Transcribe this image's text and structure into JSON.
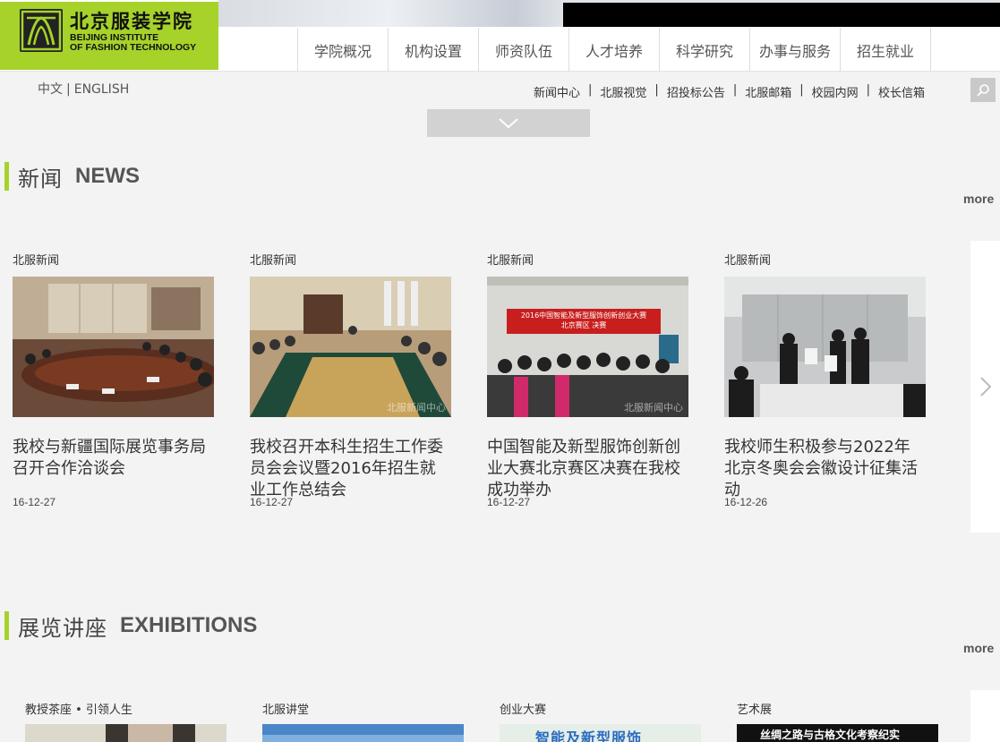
{
  "header": {
    "logo_cn": "北京服装学院",
    "logo_en_line1": "BEIJING INSTITUTE",
    "logo_en_line2": "OF FASHION TECHNOLOGY"
  },
  "nav": {
    "items": [
      {
        "label": "学院概况"
      },
      {
        "label": "机构设置"
      },
      {
        "label": "师资队伍"
      },
      {
        "label": "人才培养"
      },
      {
        "label": "科学研究"
      },
      {
        "label": "办事与服务"
      },
      {
        "label": "招生就业"
      }
    ]
  },
  "lang": {
    "cn": "中文",
    "sep": "|",
    "en": "ENGLISH"
  },
  "quicklinks": {
    "sep": "|",
    "items": [
      {
        "label": "新闻中心"
      },
      {
        "label": "北服视觉"
      },
      {
        "label": "招投标公告"
      },
      {
        "label": "北服邮箱"
      },
      {
        "label": "校园内网"
      },
      {
        "label": "校长信箱"
      }
    ]
  },
  "news": {
    "title_cn": "新闻",
    "title_en": "NEWS",
    "more": "more",
    "cards": [
      {
        "category": "北服新闻",
        "title": "我校与新疆国际展览事务局召开合作洽谈会",
        "date": "16-12-27",
        "watermark": ""
      },
      {
        "category": "北服新闻",
        "title": "我校召开本科生招生工作委员会会议暨2016年招生就业工作总结会",
        "date": "16-12-27",
        "watermark": "北服新闻中心"
      },
      {
        "category": "北服新闻",
        "title": "中国智能及新型服饰创新创业大赛北京赛区决赛在我校成功举办",
        "date": "16-12-27",
        "watermark": "北服新闻中心",
        "banner_line1": "2016中国智能及新型服饰创新创业大赛",
        "banner_line2": "北京赛区 决赛"
      },
      {
        "category": "北服新闻",
        "title": "我校师生积极参与2022年北京冬奥会会徽设计征集活动",
        "date": "16-12-26",
        "watermark": ""
      }
    ]
  },
  "exhibitions": {
    "title_cn": "展览讲座",
    "title_en": "EXHIBITIONS",
    "more": "more",
    "cards": [
      {
        "category": "教授茶座 • 引领人生",
        "image_text": ""
      },
      {
        "category": "北服讲堂",
        "image_text": ""
      },
      {
        "category": "创业大赛",
        "image_text": "智能及新型服饰"
      },
      {
        "category": "艺术展",
        "image_text": "丝绸之路与古格文化考察纪实"
      }
    ]
  },
  "colors": {
    "accent_green": "#a6d22a",
    "background": "#f3f3f3"
  }
}
